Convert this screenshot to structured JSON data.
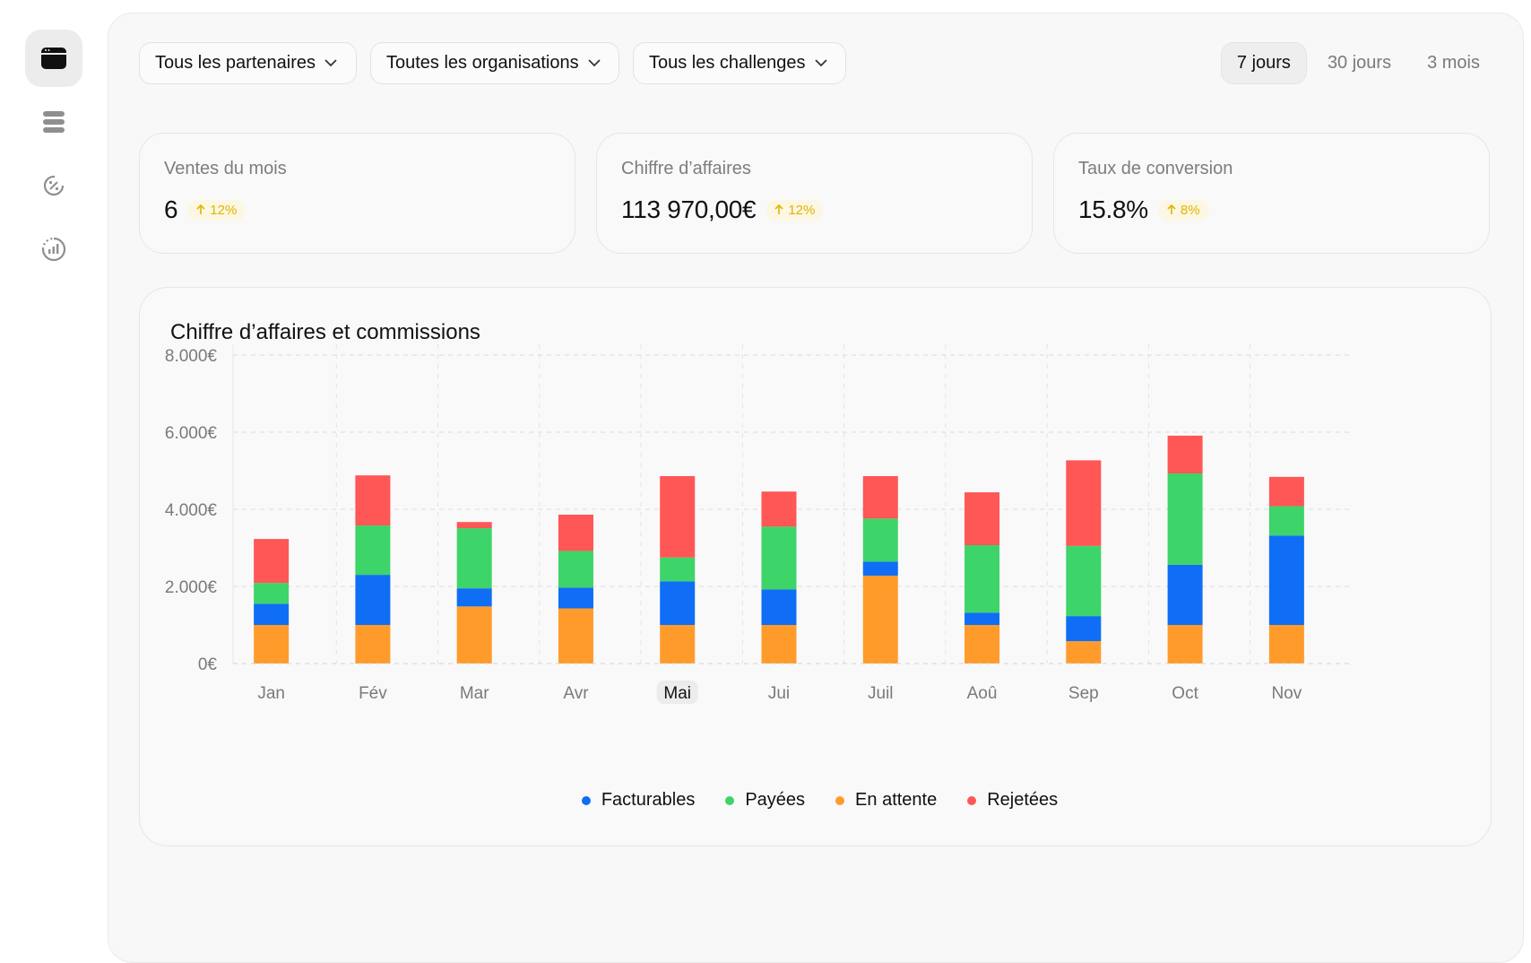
{
  "sidebar": {
    "items": [
      {
        "icon": "browser-window-icon",
        "active": true
      },
      {
        "icon": "stack-list-icon",
        "active": false
      },
      {
        "icon": "discount-percent-icon",
        "active": false
      },
      {
        "icon": "analytics-gauge-icon",
        "active": false
      }
    ]
  },
  "filters": {
    "partners": "Tous les partenaires",
    "organizations": "Toutes les organisations",
    "challenges": "Tous les challenges"
  },
  "ranges": {
    "seven_days": "7 jours",
    "thirty_days": "30 jours",
    "three_months": "3 mois",
    "selected": "7 jours"
  },
  "kpis": [
    {
      "label": "Ventes du mois",
      "value": "6",
      "change": "12%"
    },
    {
      "label": "Chiffre d’affaires",
      "value": "113 970,00€",
      "change": "12%"
    },
    {
      "label": "Taux de conversion",
      "value": "15.8%",
      "change": "8%"
    }
  ],
  "colors": {
    "facturables": "#0f6ef5",
    "payees": "#3dd46a",
    "en_attente": "#ff9b2b",
    "rejetees": "#ff5656",
    "badge_text": "#e2b400"
  },
  "chart_data": {
    "type": "bar",
    "stacked": true,
    "title": "Chiffre d’affaires et commissions",
    "categories": [
      "Jan",
      "Fév",
      "Mar",
      "Avr",
      "Mai",
      "Jui",
      "Juil",
      "Aoû",
      "Sep",
      "Oct",
      "Nov"
    ],
    "highlighted_category": "Mai",
    "y_ticks": [
      "0€",
      "2.000€",
      "4.000€",
      "6.000€",
      "8.000€"
    ],
    "ylim": [
      0,
      8000
    ],
    "grid": true,
    "legend_position": "bottom",
    "series": [
      {
        "name": "En attente",
        "key": "en_attente",
        "values": [
          1000,
          1000,
          1480,
          1430,
          1000,
          1000,
          2280,
          1000,
          580,
          1000,
          1000
        ]
      },
      {
        "name": "Facturables",
        "key": "facturables",
        "values": [
          550,
          1300,
          470,
          540,
          1130,
          920,
          360,
          320,
          650,
          1560,
          2320
        ]
      },
      {
        "name": "Payées",
        "key": "payees",
        "values": [
          540,
          1280,
          1560,
          950,
          620,
          1630,
          1120,
          1750,
          1820,
          2370,
          760
        ]
      },
      {
        "name": "Rejetées",
        "key": "rejetees",
        "values": [
          1140,
          1300,
          160,
          940,
          2110,
          910,
          1100,
          1370,
          2220,
          980,
          760
        ]
      }
    ],
    "legend": [
      "Facturables",
      "Payées",
      "En attente",
      "Rejetées"
    ]
  }
}
